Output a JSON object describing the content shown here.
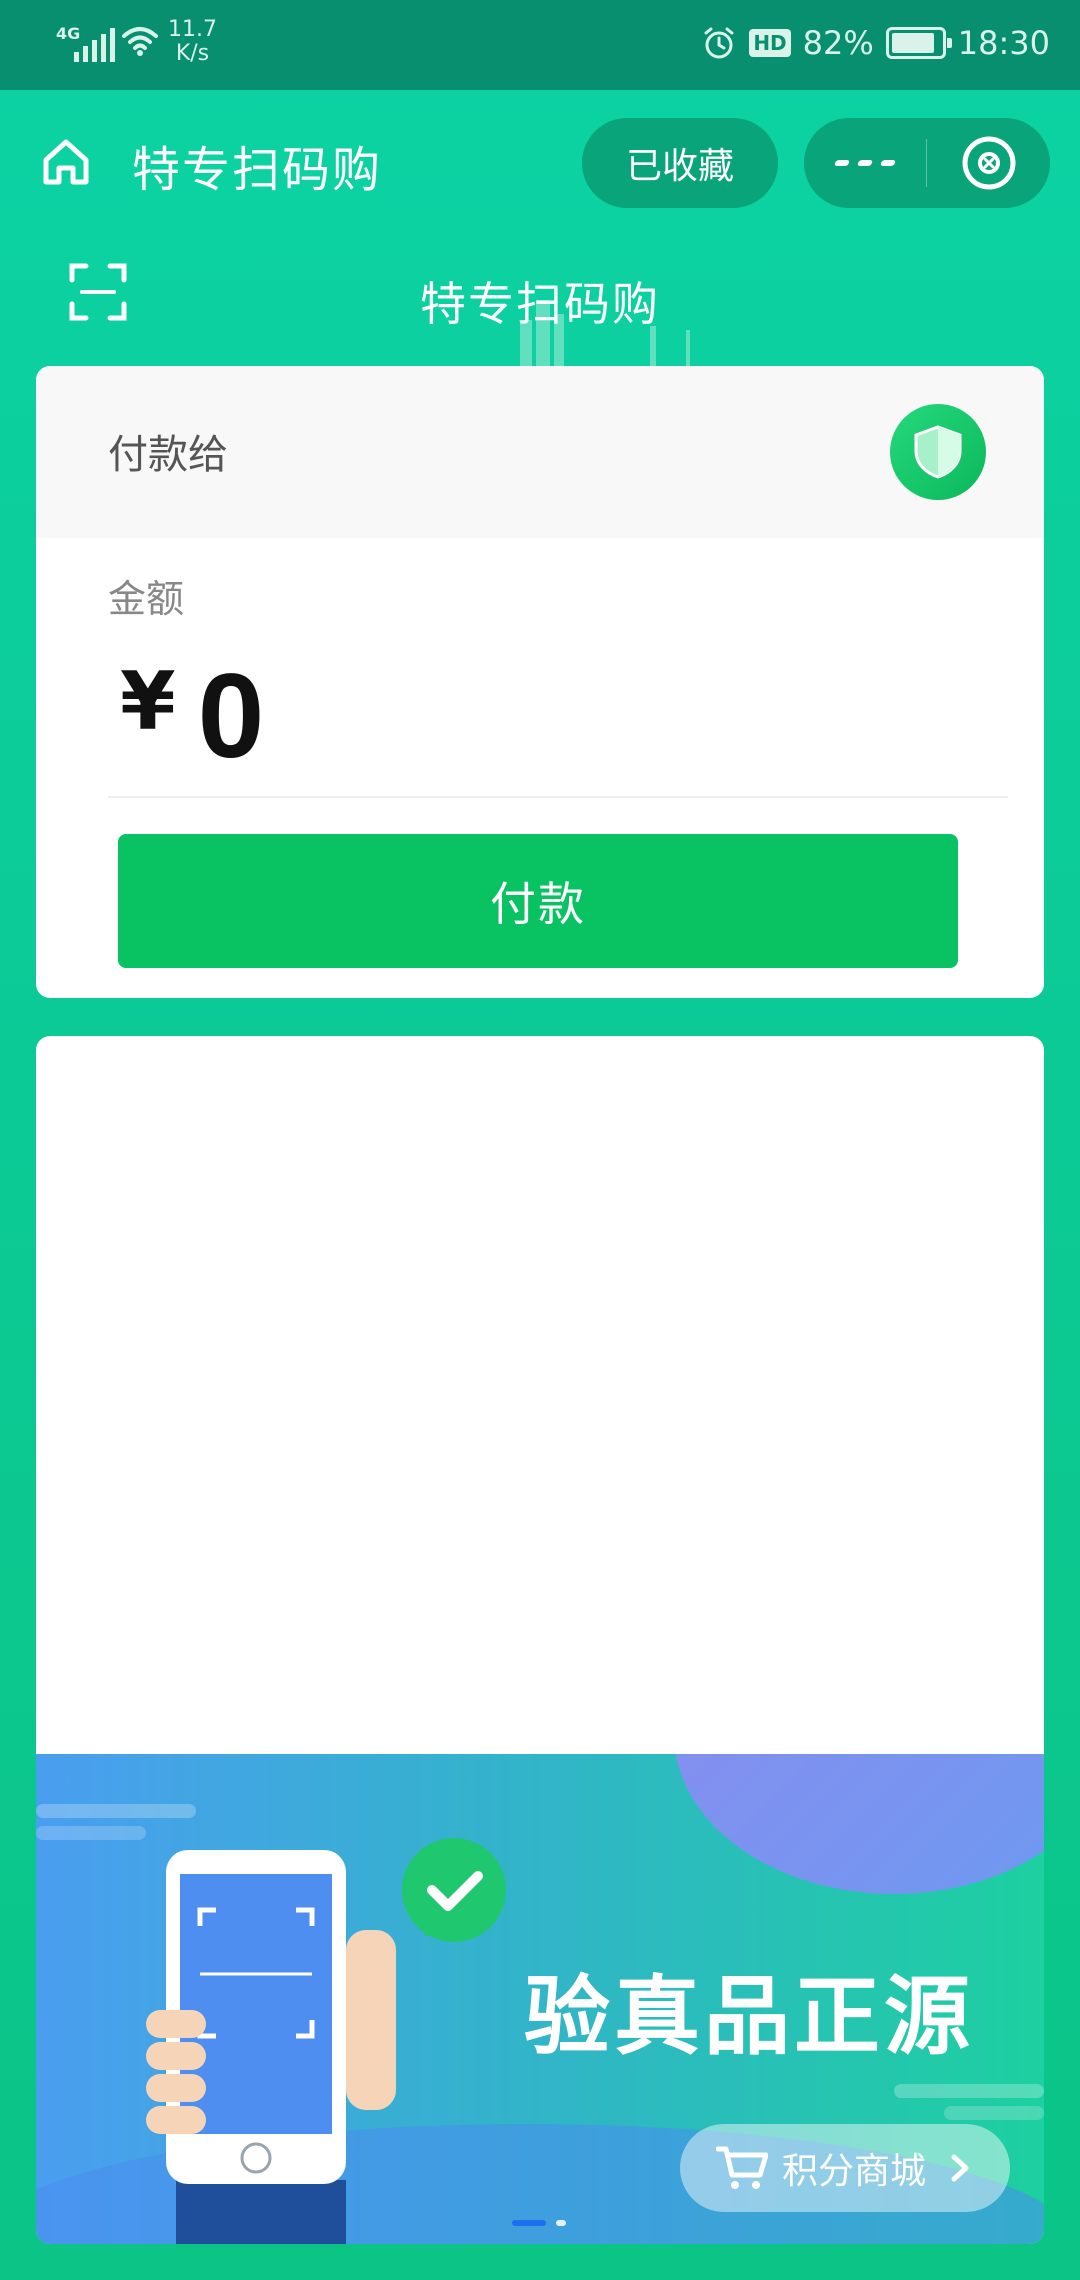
{
  "status_bar": {
    "network": "4G",
    "speed_value": "11.7",
    "speed_unit": "K/s",
    "battery": "82%",
    "time": "18:30",
    "hd_badge": "HD"
  },
  "header": {
    "title": "特专扫码购",
    "favorite_label": "已收藏"
  },
  "sub_header": {
    "title": "特专扫码购"
  },
  "payment": {
    "payee_label": "付款给",
    "amount_label": "金额",
    "currency": "¥",
    "amount": "0",
    "pay_button": "付款"
  },
  "banner": {
    "headline": "验真品正源",
    "mall_button": "积分商城",
    "slides_total": 2,
    "slide_active": 1
  },
  "colors": {
    "accent": "#0ccb98",
    "status_bar": "#078f70",
    "pay_button": "#09c261",
    "capsule": "#09a47a"
  }
}
